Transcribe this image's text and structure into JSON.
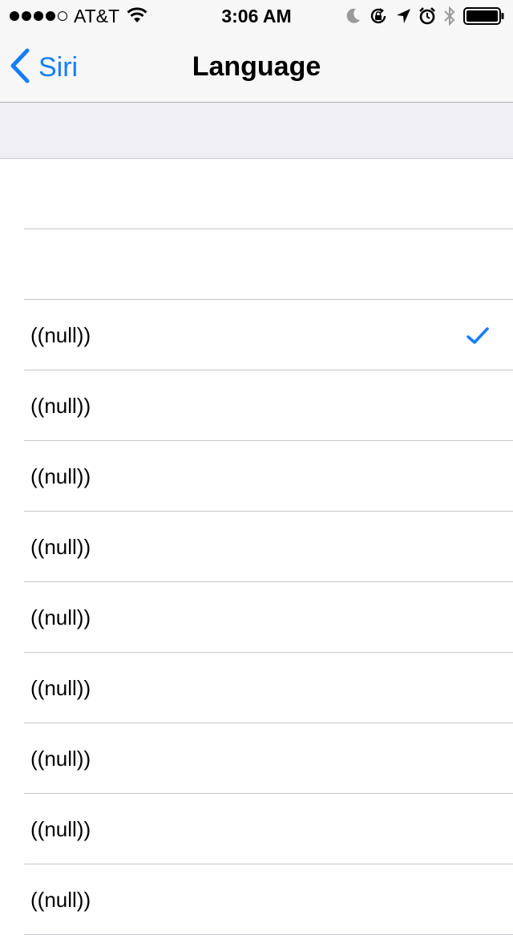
{
  "status_bar": {
    "carrier": "AT&T",
    "signal_bars_filled": 4,
    "signal_bars_total": 5,
    "time": "3:06 AM",
    "icons": [
      "wifi-icon",
      "moon-icon",
      "rotation-lock-icon",
      "location-icon",
      "alarm-icon",
      "bluetooth-icon",
      "battery-icon"
    ]
  },
  "nav": {
    "back_label": "Siri",
    "title": "Language"
  },
  "list": {
    "items": [
      {
        "label": ""
      },
      {
        "label": ""
      },
      {
        "label": "((null))",
        "checked": true
      },
      {
        "label": "((null))"
      },
      {
        "label": "((null))"
      },
      {
        "label": "((null))"
      },
      {
        "label": "((null))"
      },
      {
        "label": "((null))"
      },
      {
        "label": "((null))"
      },
      {
        "label": "((null))"
      },
      {
        "label": "((null))"
      }
    ]
  },
  "colors": {
    "accent": "#157efb",
    "background": "#ffffff",
    "section_background": "#efeff4",
    "separator": "#c8c7cc",
    "bar_background": "#f7f7f8"
  }
}
